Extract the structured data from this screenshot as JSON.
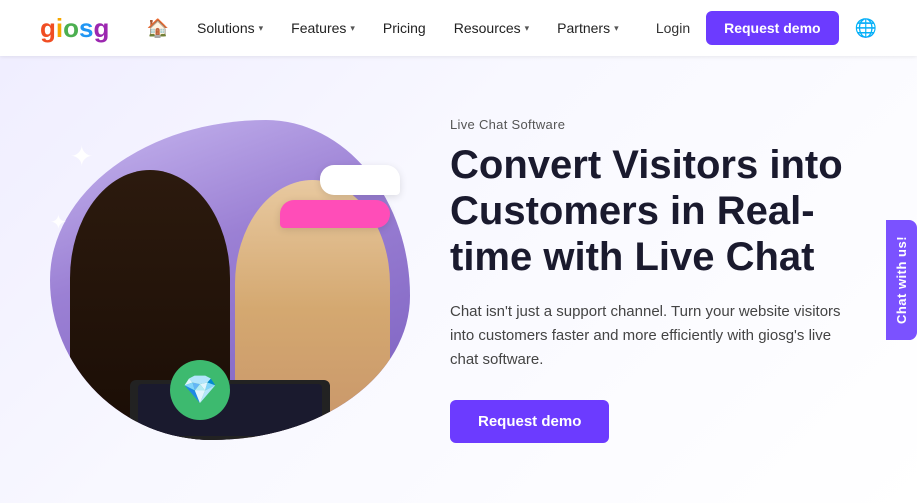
{
  "nav": {
    "logo": {
      "g1": "g",
      "i": "i",
      "o": "o",
      "s": "s",
      "g2": "g"
    },
    "home_icon": "🏠",
    "links": [
      {
        "label": "Solutions",
        "has_dropdown": true
      },
      {
        "label": "Features",
        "has_dropdown": true
      },
      {
        "label": "Pricing",
        "has_dropdown": false
      },
      {
        "label": "Resources",
        "has_dropdown": true
      },
      {
        "label": "Partners",
        "has_dropdown": true
      }
    ],
    "login_label": "Login",
    "demo_label": "Request demo",
    "globe_icon": "🌐"
  },
  "hero": {
    "label": "Live Chat Software",
    "title": "Convert Visitors into Customers in Real-time with Live Chat",
    "description": "Chat isn't just a support channel. Turn your website visitors into customers faster and more efficiently with giosg's live chat software.",
    "cta_label": "Request demo"
  },
  "chat_sidebar": {
    "label": "Chat with us!"
  }
}
